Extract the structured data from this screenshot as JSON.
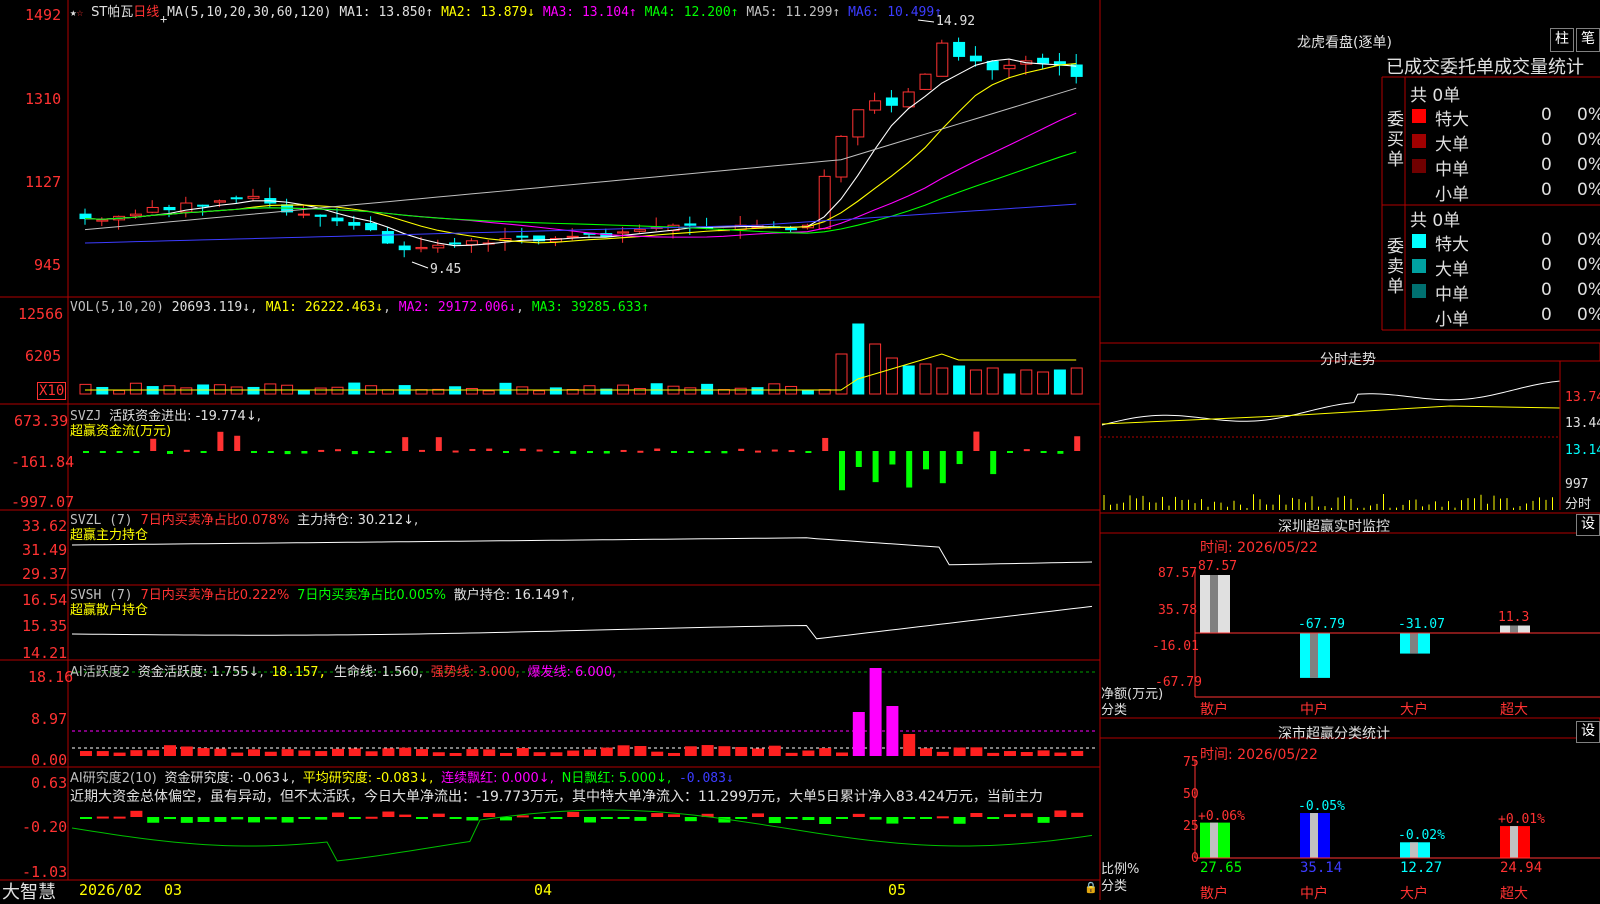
{
  "colors": {
    "up": "#ff3232",
    "down": "#00ffff",
    "grid": "#b00000",
    "axis": "#ff3232",
    "ma1": "#ffffff",
    "ma2": "#ffff00",
    "ma3": "#ff00ff",
    "ma4": "#00ff00",
    "ma5": "#c0c0c0",
    "ma6": "#3c3cff"
  },
  "stock": {
    "name": "ST帕瓦",
    "period": "日线",
    "ma_label": "MA(5,10,20,30,60,120)",
    "ma_values": [
      "MA1: 13.850↑",
      "MA2: 13.879↓",
      "MA3: 13.104↑",
      "MA4: 12.200↑",
      "MA5: 11.299↑",
      "MA6: 10.499↑"
    ],
    "high_mark": "14.92",
    "low_mark": "9.45",
    "price_axis": [
      "1492",
      "1310",
      "1127",
      "945"
    ]
  },
  "vol": {
    "header": "VOL(5,10,20)",
    "value": "20693.119↓",
    "ma1": "MA1: 26222.463↓",
    "ma2": "MA2: 29172.006↓",
    "ma3": "MA3: 39285.633↑",
    "axis": [
      "12566",
      "6205"
    ],
    "unit": "X10"
  },
  "svzj": {
    "header": "SVZJ",
    "label": "活跃资金进出: -19.774↓,",
    "sub": "超赢资金流(万元)",
    "axis": [
      "673.39",
      "-161.84",
      "-997.07"
    ]
  },
  "svzl": {
    "header": "SVZL (7)",
    "ratio": "7日内买卖净占比0.078%",
    "hold": "主力持仓: 30.212↓,",
    "sub": "超赢主力持仓",
    "axis": [
      "33.62",
      "31.49",
      "29.37"
    ]
  },
  "svsh": {
    "header": "SVSH (7)",
    "ratio1": "7日内买卖净占比0.222%",
    "ratio2": "7日内买卖净占比0.005%",
    "hold": "散户持仓: 16.149↑,",
    "sub": "超赢散户持仓",
    "axis": [
      "16.54",
      "15.35",
      "14.21"
    ]
  },
  "ai2": {
    "header": "AI活跃度2",
    "v1": "资金活跃度: 1.755↓,",
    "v2": "18.157,",
    "v3": "生命线: 1.560,",
    "v4": "强势线: 3.000,",
    "v5": "爆发线: 6.000,",
    "axis": [
      "18.16",
      "8.97",
      "0.00"
    ]
  },
  "ai3": {
    "header": "AI研究度2(10)",
    "v1": "资金研究度: -0.063↓,",
    "v2": "平均研究度: -0.083↓,",
    "v3": "连续飘红: 0.000↓,",
    "v4": "N日飘红: 5.000↓,",
    "v5": "-0.083↓",
    "comment": "近期大资金总体偏空，虽有异动，但不太活跃，今日大单净流出：-19.773万元，其中特大单净流入：11.299万元，大单5日累计净入83.424万元，当前主力",
    "axis": [
      "0.63",
      "-0.20",
      "-1.03"
    ]
  },
  "bottom": {
    "brand": "大智慧",
    "dates": [
      "2026/02",
      "03",
      "04",
      "05"
    ]
  },
  "dragon": {
    "title": "龙虎看盘(逐单)",
    "btn1": "柱",
    "btn2": "笔",
    "table_title": "已成交委托单成交量统计",
    "buy_label": "委买单",
    "buy_total": "共 0单",
    "sell_label": "委卖单",
    "sell_total": "共 0单",
    "buy_rows": [
      {
        "name": "特大",
        "v": "0",
        "p": "0%",
        "c": "#ff0000"
      },
      {
        "name": "大单",
        "v": "0",
        "p": "0%",
        "c": "#a00000"
      },
      {
        "name": "中单",
        "v": "0",
        "p": "0%",
        "c": "#700000"
      },
      {
        "name": "小单",
        "v": "0",
        "p": "0%",
        "c": "#000000"
      }
    ],
    "sell_rows": [
      {
        "name": "特大",
        "v": "0",
        "p": "0%",
        "c": "#00ffff"
      },
      {
        "name": "大单",
        "v": "0",
        "p": "0%",
        "c": "#00a0a0"
      },
      {
        "name": "中单",
        "v": "0",
        "p": "0%",
        "c": "#007070"
      },
      {
        "name": "小单",
        "v": "0",
        "p": "0%",
        "c": "#000000"
      }
    ]
  },
  "intraday": {
    "title": "分时走势",
    "axis": [
      "13.74",
      "13.44",
      "13.14"
    ],
    "vol": "997",
    "label": "分时"
  },
  "monitor": {
    "title": "深圳超赢实时监控",
    "btn": "设",
    "time": "时间: 2026/05/22",
    "axis": [
      "87.57",
      "35.78",
      "-16.01",
      "-67.79"
    ],
    "ylabel": "净额(万元)",
    "xlabel": "分类",
    "bars": [
      {
        "cat": "散户",
        "value": 87.57,
        "label": "87.57",
        "fill": "#e0e0e0"
      },
      {
        "cat": "中户",
        "value": -67.79,
        "label": "-67.79",
        "fill": "#00ffff"
      },
      {
        "cat": "大户",
        "value": -31.07,
        "label": "-31.07",
        "fill": "#00ffff"
      },
      {
        "cat": "超大",
        "value": 11.3,
        "label": "11.3",
        "fill": "#e0e0e0"
      }
    ]
  },
  "classify": {
    "title": "深市超赢分类统计",
    "btn": "设",
    "time": "时间: 2026/05/22",
    "axis": [
      "75",
      "50",
      "25",
      "0"
    ],
    "ylabel": "比例%",
    "xlabel": "分类",
    "bars": [
      {
        "cat": "散户",
        "value": 27.65,
        "label": "27.65",
        "delta": "+0.06%",
        "fill": "#00ff00"
      },
      {
        "cat": "中户",
        "value": 35.14,
        "label": "35.14",
        "delta": "-0.05%",
        "fill": "#0000ff"
      },
      {
        "cat": "大户",
        "value": 12.27,
        "label": "12.27",
        "delta": "-0.02%",
        "fill": "#00ffff"
      },
      {
        "cat": "超大",
        "value": 24.94,
        "label": "24.94",
        "delta": "+0.01%",
        "fill": "#ff0000"
      }
    ]
  }
}
